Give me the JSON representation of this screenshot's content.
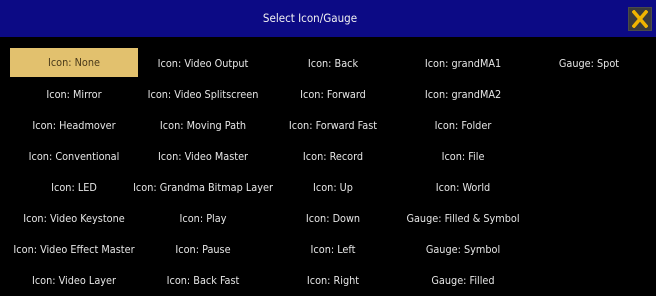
{
  "title": "Select Icon/Gauge",
  "colors": {
    "titlebar": "#0c0a85",
    "selected_bg": "#e2c16e",
    "close_icon": "#f0b400"
  },
  "close_button": {
    "icon": "close-icon"
  },
  "selected": "Icon: None",
  "grid": [
    [
      "Icon: None",
      "Icon: Video Output",
      "Icon: Back",
      "Icon: grandMA1",
      "Gauge: Spot"
    ],
    [
      "Icon: Mirror",
      "Icon: Video Splitscreen",
      "Icon: Forward",
      "Icon: grandMA2",
      ""
    ],
    [
      "Icon: Headmover",
      "Icon: Moving Path",
      "Icon: Forward Fast",
      "Icon: Folder",
      ""
    ],
    [
      "Icon: Conventional",
      "Icon: Video Master",
      "Icon: Record",
      "Icon: File",
      ""
    ],
    [
      "Icon: LED",
      "Icon: Grandma Bitmap Layer",
      "Icon: Up",
      "Icon: World",
      ""
    ],
    [
      "Icon: Video Keystone",
      "Icon: Play",
      "Icon: Down",
      "Gauge: Filled & Symbol",
      ""
    ],
    [
      "Icon: Video Effect Master",
      "Icon: Pause",
      "Icon: Left",
      "Gauge: Symbol",
      ""
    ],
    [
      "Icon: Video Layer",
      "Icon: Back Fast",
      "Icon: Right",
      "Gauge: Filled",
      ""
    ]
  ]
}
